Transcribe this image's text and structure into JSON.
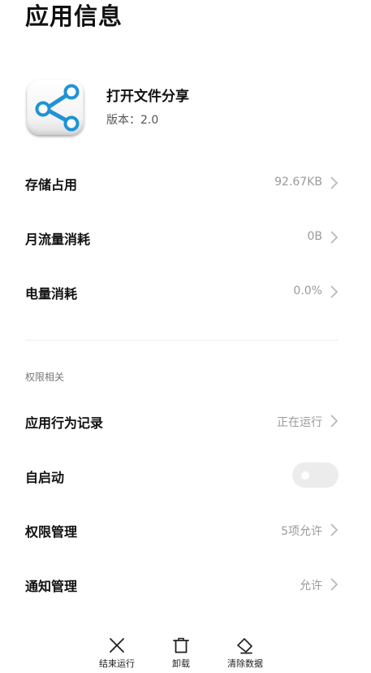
{
  "page": {
    "title": "应用信息"
  },
  "app": {
    "name": "打开文件分享",
    "version": "版本：2.0",
    "icon": "share-icon",
    "icon_color": "#1f93d6"
  },
  "usage": {
    "storage": {
      "label": "存储占用",
      "value": "92.67KB"
    },
    "traffic": {
      "label": "月流量消耗",
      "value": "0B"
    },
    "battery": {
      "label": "电量消耗",
      "value": "0.0%"
    }
  },
  "permissions": {
    "section_title": "权限相关",
    "behavior": {
      "label": "应用行为记录",
      "value": "正在运行"
    },
    "autostart": {
      "label": "自启动",
      "enabled": false
    },
    "manage": {
      "label": "权限管理",
      "value": "5项允许"
    },
    "notify": {
      "label": "通知管理",
      "value": "允许"
    }
  },
  "actions": {
    "stop": {
      "label": "结束运行",
      "icon": "close-icon"
    },
    "uninstall": {
      "label": "卸载",
      "icon": "trash-icon"
    },
    "clear": {
      "label": "清除数据",
      "icon": "eraser-icon"
    }
  },
  "colors": {
    "text_primary": "#111111",
    "text_secondary": "#9a9a9a",
    "toggle_off": "#ececec"
  }
}
